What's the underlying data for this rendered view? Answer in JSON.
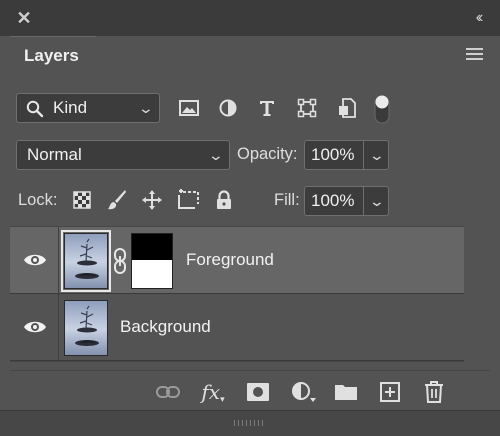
{
  "panel": {
    "tab_label": "Layers",
    "close_glyph": "✕",
    "collapse_glyph": "‹‹"
  },
  "filter": {
    "label": "Kind",
    "icons": [
      "image-filter-icon",
      "adjustment-filter-icon",
      "type-filter-icon",
      "shape-filter-icon",
      "smart-object-filter-icon",
      "filter-toggle-switch"
    ]
  },
  "blend": {
    "mode": "Normal",
    "opacity_label": "Opacity:",
    "opacity_value": "100%"
  },
  "lock": {
    "label": "Lock:",
    "icons": [
      "lock-transparent-pixels-icon",
      "lock-image-pixels-icon",
      "lock-position-icon",
      "prevent-autonest-icon",
      "lock-all-icon"
    ],
    "fill_label": "Fill:",
    "fill_value": "100%"
  },
  "layers": [
    {
      "name": "Foreground",
      "selected": true,
      "visible": true,
      "has_mask": true,
      "linked": true
    },
    {
      "name": "Background",
      "selected": false,
      "visible": true,
      "has_mask": false,
      "linked": false
    }
  ],
  "footer": {
    "icons": [
      "link-layers-icon",
      "fx-icon",
      "add-mask-icon",
      "adjustment-layer-icon",
      "group-folder-icon",
      "new-layer-icon",
      "delete-layer-icon"
    ],
    "fx_text": "fx"
  },
  "colors": {
    "panel_bg": "#535353",
    "header_bg": "#3b3b3b",
    "selected_row": "#666666",
    "field_bg": "#3c3c3c"
  }
}
